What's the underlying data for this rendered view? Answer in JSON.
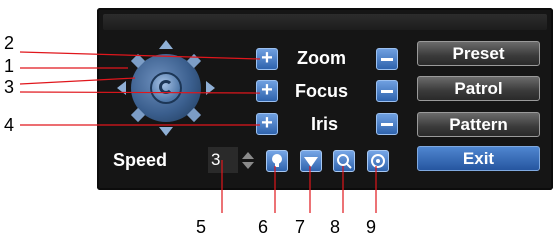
{
  "ptz_panel": {
    "zoom_label": "Zoom",
    "focus_label": "Focus",
    "iris_label": "Iris",
    "speed_label": "Speed",
    "speed_value": "3",
    "plus_glyph": "+",
    "buttons": {
      "preset": "Preset",
      "patrol": "Patrol",
      "pattern": "Pattern",
      "exit": "Exit"
    },
    "icons": [
      "light-icon",
      "wiper-icon",
      "zoom-lens-icon",
      "auto-scan-icon"
    ]
  },
  "callouts": {
    "c1": "1",
    "c2": "2",
    "c3": "3",
    "c4": "4",
    "c5": "5",
    "c6": "6",
    "c7": "7",
    "c8": "8",
    "c9": "9"
  },
  "colors": {
    "panel_bg": "#151515",
    "accent_blue": "#2f63ad",
    "callout_line": "#e0161c"
  }
}
